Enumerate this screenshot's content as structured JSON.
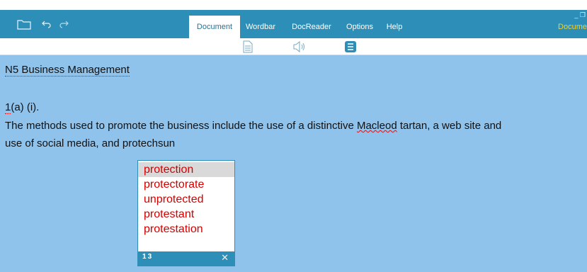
{
  "window": {
    "brand": "Docume",
    "controls": "_ ❐"
  },
  "titlebar_icons": [
    {
      "name": "open-folder-icon"
    },
    {
      "name": "undo-icon"
    },
    {
      "name": "redo-icon"
    }
  ],
  "tabs": [
    {
      "label": "Document",
      "active": true
    },
    {
      "label": "Wordbar",
      "active": false
    },
    {
      "label": "DocReader",
      "active": false
    },
    {
      "label": "Options",
      "active": false
    },
    {
      "label": "Help",
      "active": false
    }
  ],
  "toolbar": [
    {
      "name": "document-icon"
    },
    {
      "name": "speaker-icon"
    },
    {
      "name": "list-panel-icon",
      "active": true
    }
  ],
  "document": {
    "title": "N5 Business Management",
    "question_ref_prefix": "1",
    "question_ref_rest": "(a) (i).",
    "para_line1_before": "The methods used to promote the business include the use of a distinctive ",
    "para_line1_misspelled": "Macleod",
    "para_line1_after": " tartan, a web site and",
    "para_line2": "use of social media, and protechsun"
  },
  "suggestions": {
    "items": [
      "protection",
      "protectorate",
      "unprotected",
      "protestant",
      "protestation"
    ],
    "selected_index": 0,
    "numbers_label": "1 3",
    "close_label": "✕"
  },
  "colors": {
    "accent": "#2d8fb7",
    "document_bg": "#8fc3ec",
    "suggestion_text": "#d40000",
    "brand": "#f2d02a"
  }
}
